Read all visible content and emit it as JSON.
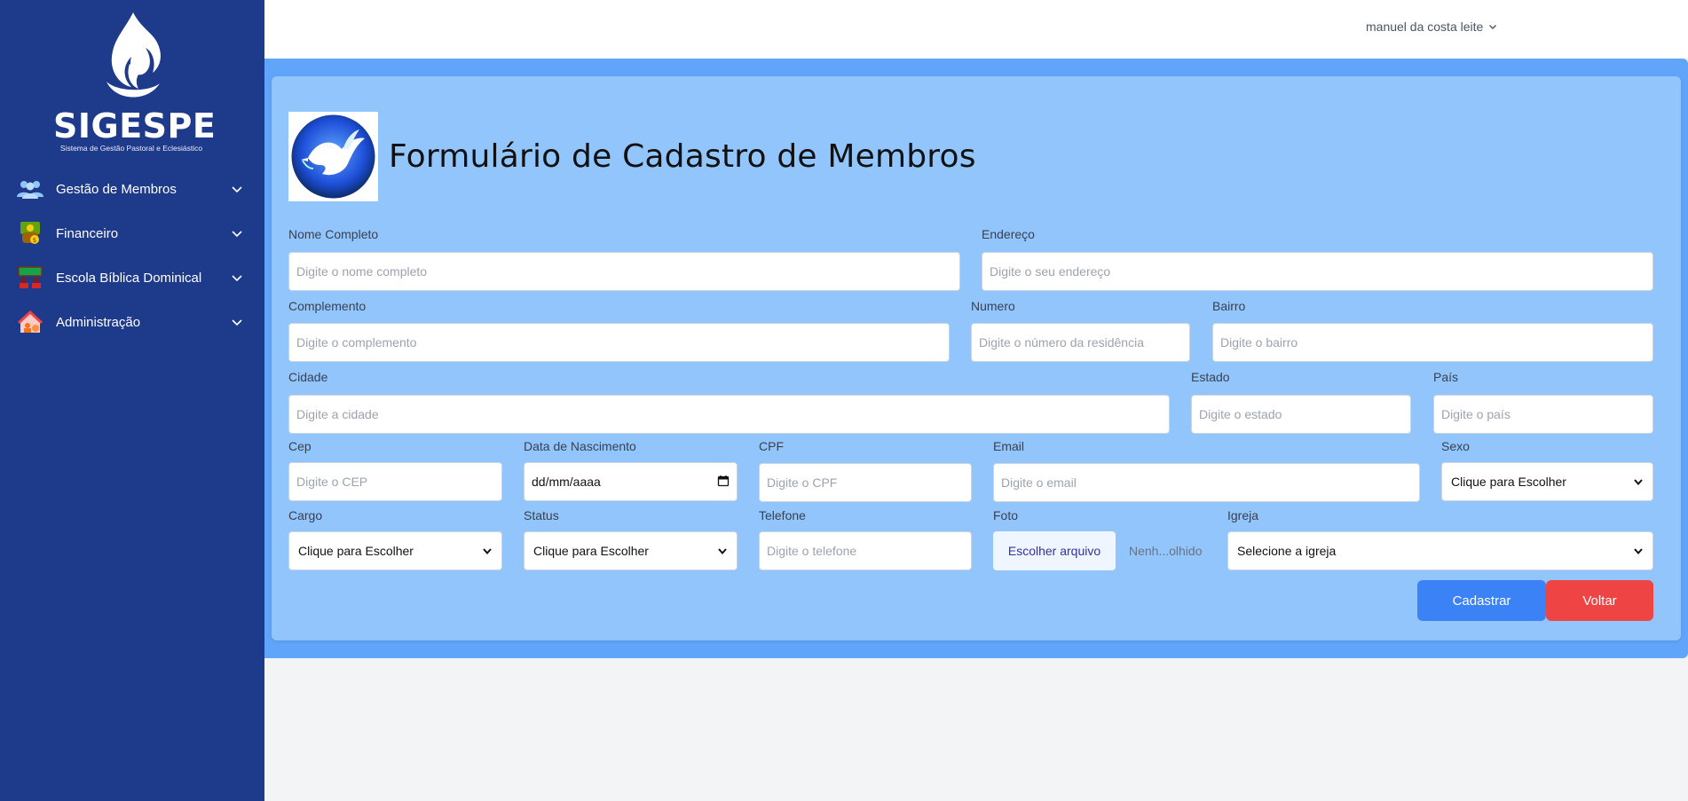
{
  "sidebar": {
    "brand": "SIGESPE",
    "brand_sub": "Sistema de Gestão Pastoral e Eclesiástico",
    "items": [
      {
        "label": "Gestão de Membros",
        "icon": "people-icon"
      },
      {
        "label": "Financeiro",
        "icon": "money-icon"
      },
      {
        "label": "Escola Bíblica Dominical",
        "icon": "classroom-icon"
      },
      {
        "label": "Administração",
        "icon": "house-admin-icon"
      }
    ]
  },
  "header": {
    "user_name": "manuel da costa leite"
  },
  "form": {
    "title": "Formulário de Cadastro de Membros",
    "fields": {
      "nome": {
        "label": "Nome Completo",
        "placeholder": "Digite o nome completo"
      },
      "endereco": {
        "label": "Endereço",
        "placeholder": "Digite o seu endereço"
      },
      "complemento": {
        "label": "Complemento",
        "placeholder": "Digite o complemento"
      },
      "numero": {
        "label": "Numero",
        "placeholder": "Digite o número da residência"
      },
      "bairro": {
        "label": "Bairro",
        "placeholder": "Digite o bairro"
      },
      "cidade": {
        "label": "Cidade",
        "placeholder": "Digite a cidade"
      },
      "estado": {
        "label": "Estado",
        "placeholder": "Digite o estado"
      },
      "pais": {
        "label": "País",
        "placeholder": "Digite o país"
      },
      "cep": {
        "label": "Cep",
        "placeholder": "Digite o CEP"
      },
      "nascimento": {
        "label": "Data de Nascimento",
        "value": "dd/mm/aaaa"
      },
      "cpf": {
        "label": "CPF",
        "placeholder": "Digite o CPF"
      },
      "email": {
        "label": "Email",
        "placeholder": "Digite o email"
      },
      "sexo": {
        "label": "Sexo",
        "selected": "Clique para Escolher"
      },
      "cargo": {
        "label": "Cargo",
        "selected": "Clique para Escolher"
      },
      "status": {
        "label": "Status",
        "selected": "Clique para Escolher"
      },
      "telefone": {
        "label": "Telefone",
        "placeholder": "Digite o telefone"
      },
      "foto": {
        "label": "Foto",
        "button": "Escolher arquivo",
        "status": "Nenh...olhido"
      },
      "igreja": {
        "label": "Igreja",
        "selected": "Selecione a igreja"
      }
    },
    "buttons": {
      "submit": "Cadastrar",
      "back": "Voltar"
    }
  },
  "colors": {
    "sidebar_bg": "#1e3a8a",
    "outer_bg": "#60a5fa",
    "card_bg": "#93c5fd",
    "primary_button": "#3b82f6",
    "danger_button": "#ef4444"
  }
}
